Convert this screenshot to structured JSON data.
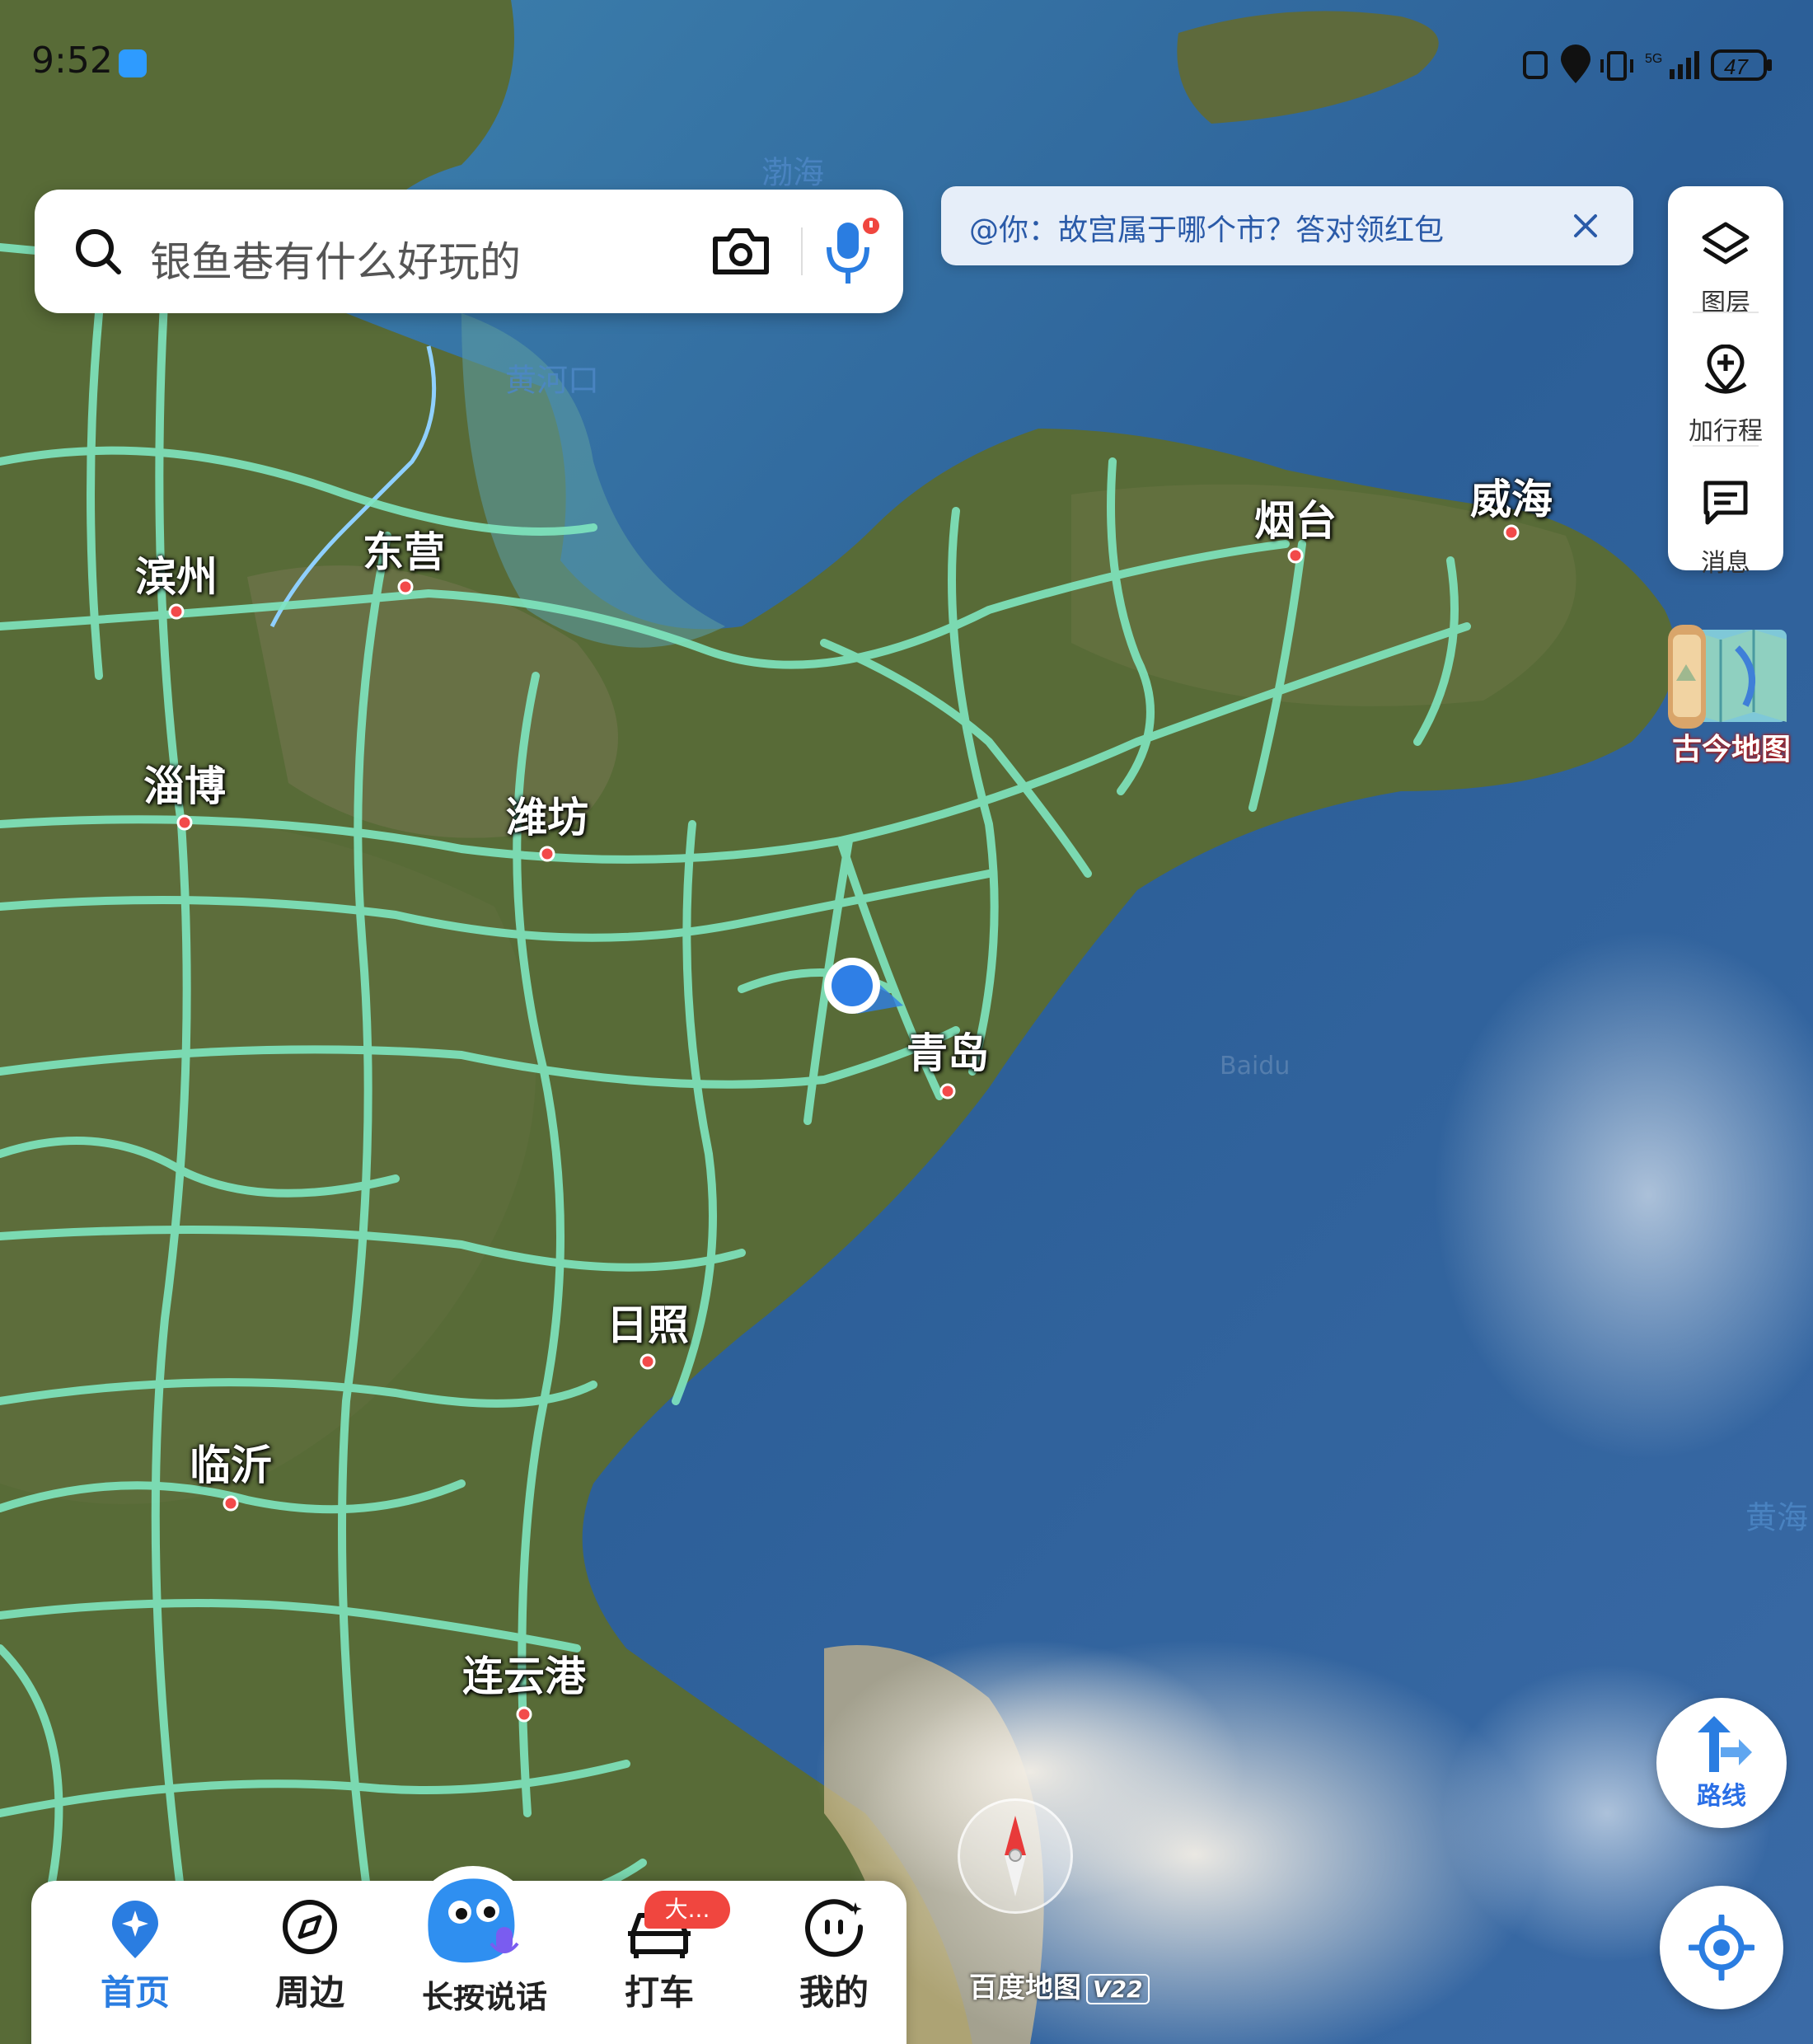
{
  "status": {
    "time": "9:52",
    "battery": "47",
    "network": "5G"
  },
  "search": {
    "placeholder": "银鱼巷有什么好玩的"
  },
  "banner": {
    "text": "@你：故宫属于哪个市？答对领红包"
  },
  "right_panel": {
    "layers": "图层",
    "add_trip": "加行程",
    "messages": "消息"
  },
  "gujin_map": "古今地图",
  "route_button": "路线",
  "map_logo": {
    "name": "百度地图",
    "version": "V22"
  },
  "watermark": "Baidu",
  "map": {
    "cities": [
      {
        "name": "滨州"
      },
      {
        "name": "东营"
      },
      {
        "name": "淄博"
      },
      {
        "name": "潍坊"
      },
      {
        "name": "烟台"
      },
      {
        "name": "威海"
      },
      {
        "name": "青岛"
      },
      {
        "name": "日照"
      },
      {
        "name": "临沂"
      },
      {
        "name": "连云港"
      }
    ],
    "water_labels": [
      {
        "name": "渤海"
      },
      {
        "name": "黄河口"
      },
      {
        "name": "黄海"
      }
    ]
  },
  "bottom_nav": {
    "home": "首页",
    "nearby": "周边",
    "voice": "长按说话",
    "taxi": "打车",
    "taxi_badge": "大...",
    "me": "我的"
  },
  "colors": {
    "road": "#6fe0b4",
    "accent": "#2a7de1",
    "badge": "#f0463f",
    "city_dot": "#f24a4a"
  }
}
